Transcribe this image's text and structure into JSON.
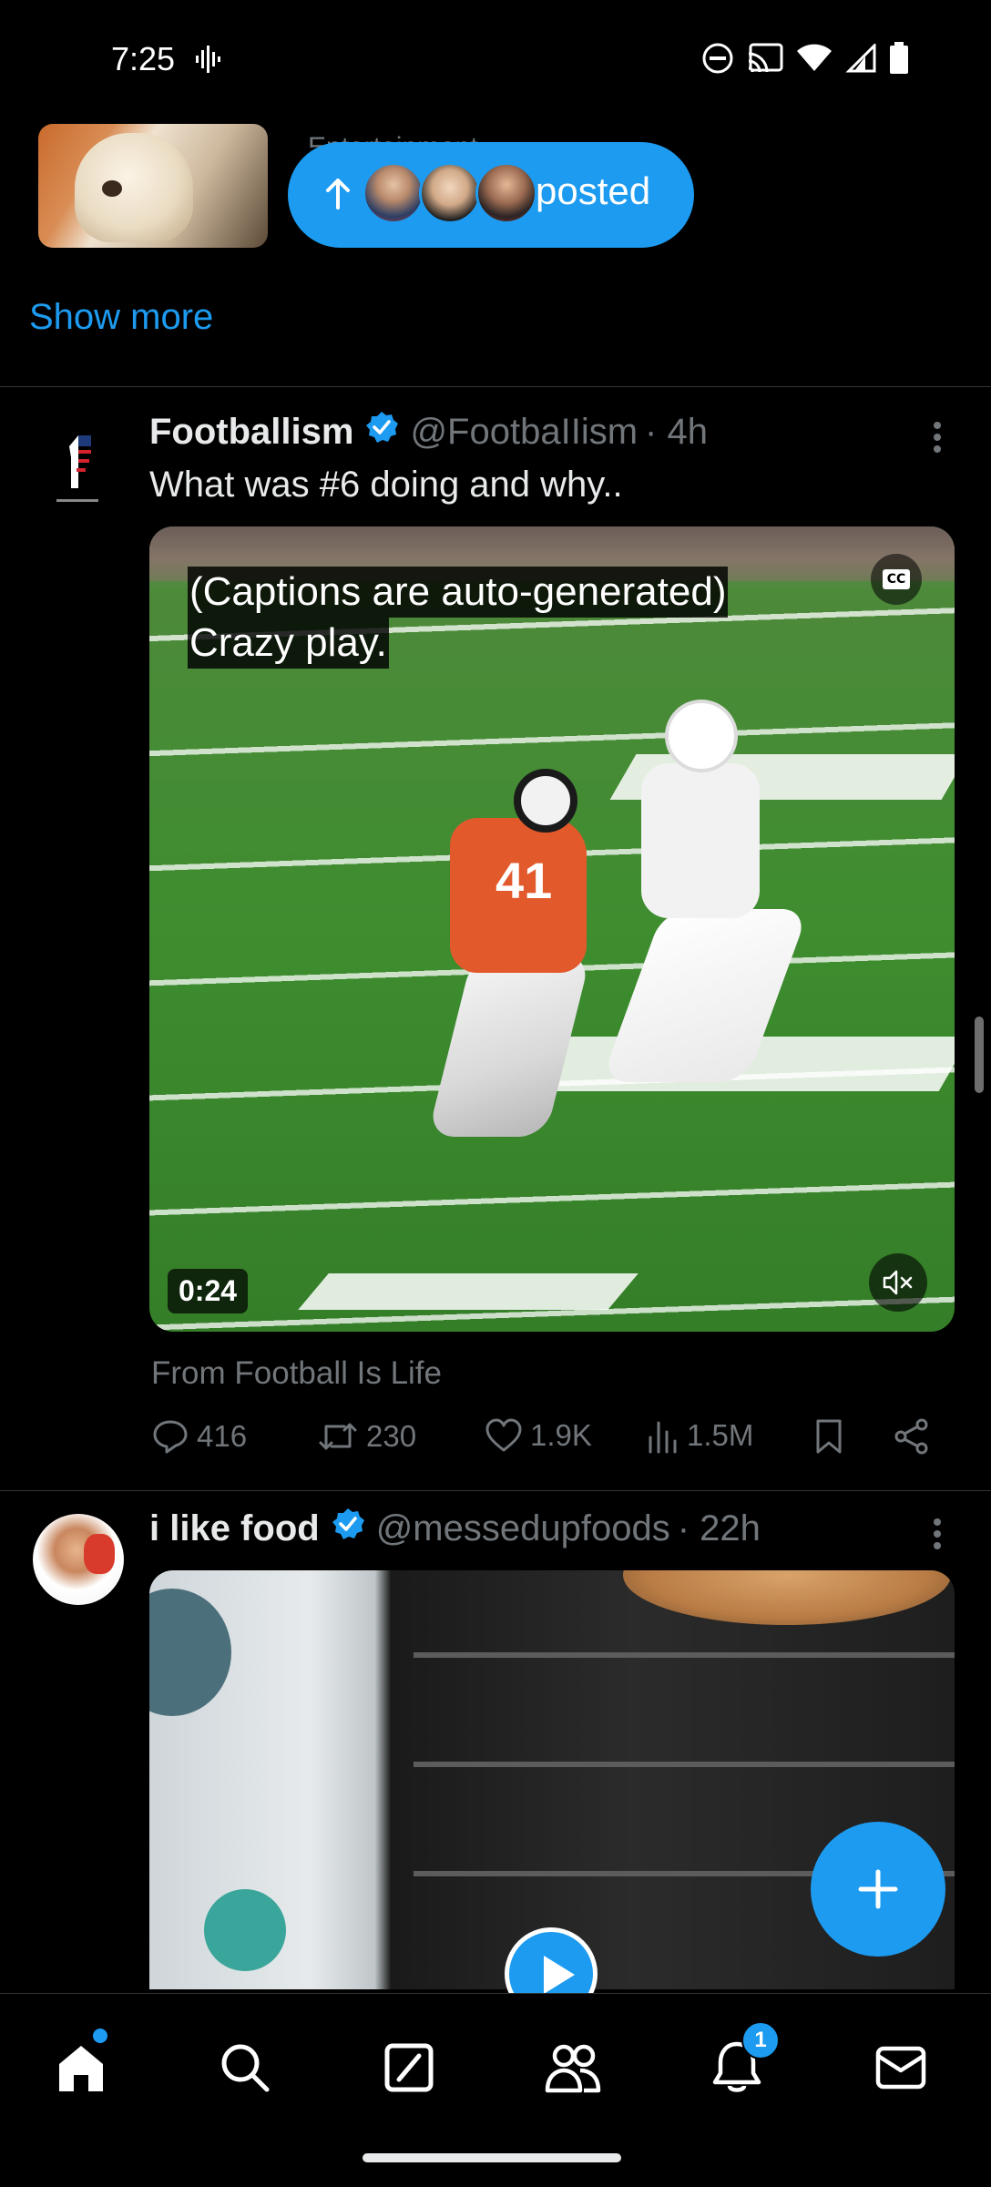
{
  "status_bar": {
    "time": "7:25"
  },
  "top": {
    "trend_category": "Entertainment",
    "posted_pill_label": "posted",
    "show_more": "Show more"
  },
  "tweet1": {
    "name": "Footballism",
    "handle": "@FootbaIIism",
    "age": "· 4h",
    "text": "What was #6 doing and why..",
    "caption_line1": "(Captions are auto-generated)",
    "caption_line2": "Crazy play.",
    "cc_label": "CC",
    "duration": "0:24",
    "jersey_number": "41",
    "from": "From Football Is Life",
    "stats": {
      "replies": "416",
      "reposts": "230",
      "likes": "1.9K",
      "views": "1.5M"
    }
  },
  "tweet2": {
    "name": "i like food",
    "handle": "@messedupfoods",
    "age": "· 22h"
  },
  "bottom_nav": {
    "notification_count": "1"
  },
  "colors": {
    "accent": "#1d9bf0",
    "background": "#000000",
    "muted_text": "#71767b",
    "primary_text": "#e7e9ea"
  }
}
